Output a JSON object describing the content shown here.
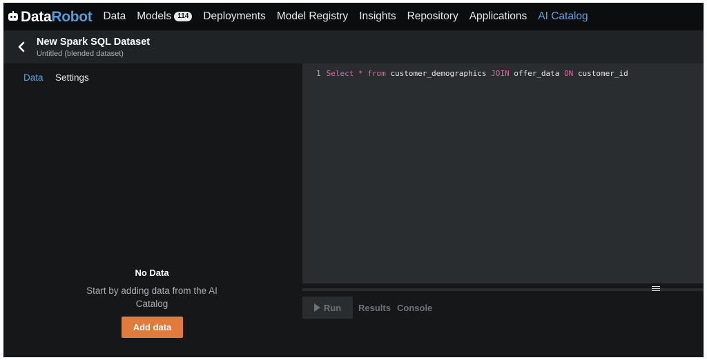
{
  "nav": {
    "logo_data": "Data",
    "logo_robot": "Robot",
    "items": [
      {
        "label": "Data"
      },
      {
        "label": "Models",
        "badge": "114"
      },
      {
        "label": "Deployments"
      },
      {
        "label": "Model Registry"
      },
      {
        "label": "Insights"
      },
      {
        "label": "Repository"
      },
      {
        "label": "Applications"
      },
      {
        "label": "AI Catalog",
        "active": true
      }
    ]
  },
  "header": {
    "title": "New Spark SQL Dataset",
    "subtitle": "Untitled (blended dataset)"
  },
  "left_panel": {
    "tabs": [
      "Data",
      "Settings"
    ],
    "active_tab": "Data",
    "empty_title": "No Data",
    "empty_desc": "Start by adding data from the AI Catalog",
    "add_button": "Add data"
  },
  "editor": {
    "line_number": "1",
    "tokens": {
      "select": "Select",
      "star": "*",
      "from": "from",
      "table1": "customer_demographics",
      "join": "JOIN",
      "table2": "offer_data",
      "on": "ON",
      "column": "customer_id"
    }
  },
  "bottom": {
    "run_label": "Run",
    "tabs": [
      "Results",
      "Console"
    ]
  },
  "colors": {
    "accent": "#5ea2e0",
    "button": "#e07b39",
    "keyword": "#d86ba3"
  }
}
